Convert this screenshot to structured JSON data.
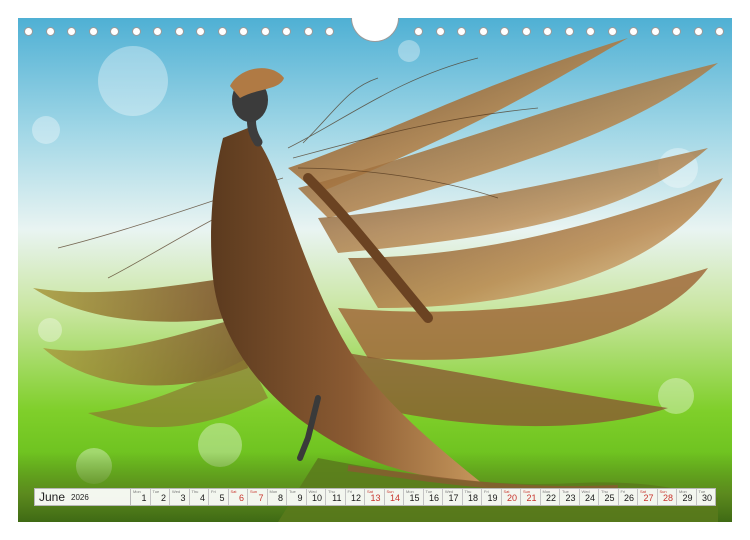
{
  "calendar": {
    "month": "June",
    "year": "2026",
    "days": [
      {
        "num": "1",
        "wd": "Mon",
        "weekend": false
      },
      {
        "num": "2",
        "wd": "Tue",
        "weekend": false
      },
      {
        "num": "3",
        "wd": "Wed",
        "weekend": false
      },
      {
        "num": "4",
        "wd": "Thu",
        "weekend": false
      },
      {
        "num": "5",
        "wd": "Fri",
        "weekend": false
      },
      {
        "num": "6",
        "wd": "Sat",
        "weekend": true
      },
      {
        "num": "7",
        "wd": "Sun",
        "weekend": true
      },
      {
        "num": "8",
        "wd": "Mon",
        "weekend": false
      },
      {
        "num": "9",
        "wd": "Tue",
        "weekend": false
      },
      {
        "num": "10",
        "wd": "Wed",
        "weekend": false
      },
      {
        "num": "11",
        "wd": "Thu",
        "weekend": false
      },
      {
        "num": "12",
        "wd": "Fri",
        "weekend": false
      },
      {
        "num": "13",
        "wd": "Sat",
        "weekend": true
      },
      {
        "num": "14",
        "wd": "Sun",
        "weekend": true
      },
      {
        "num": "15",
        "wd": "Mon",
        "weekend": false
      },
      {
        "num": "16",
        "wd": "Tue",
        "weekend": false
      },
      {
        "num": "17",
        "wd": "Wed",
        "weekend": false
      },
      {
        "num": "18",
        "wd": "Thu",
        "weekend": false
      },
      {
        "num": "19",
        "wd": "Fri",
        "weekend": false
      },
      {
        "num": "20",
        "wd": "Sat",
        "weekend": true
      },
      {
        "num": "21",
        "wd": "Sun",
        "weekend": true
      },
      {
        "num": "22",
        "wd": "Mon",
        "weekend": false
      },
      {
        "num": "23",
        "wd": "Tue",
        "weekend": false
      },
      {
        "num": "24",
        "wd": "Wed",
        "weekend": false
      },
      {
        "num": "25",
        "wd": "Thu",
        "weekend": false
      },
      {
        "num": "26",
        "wd": "Fri",
        "weekend": false
      },
      {
        "num": "27",
        "wd": "Sat",
        "weekend": true
      },
      {
        "num": "28",
        "wd": "Sun",
        "weekend": true
      },
      {
        "num": "29",
        "wd": "Mon",
        "weekend": false
      },
      {
        "num": "30",
        "wd": "Tue",
        "weekend": false
      }
    ]
  },
  "colors": {
    "weekend": "#c8342c",
    "weekday": "#1a1a1a",
    "dress": "#8a5a32",
    "dress_highlight": "#d8b27a",
    "sky": "#4fb0d4",
    "meadow": "#7fcf2a"
  },
  "icons": {
    "binding_hole": "wire-binding-hole-icon",
    "hanger": "wall-hanger-notch-icon"
  }
}
